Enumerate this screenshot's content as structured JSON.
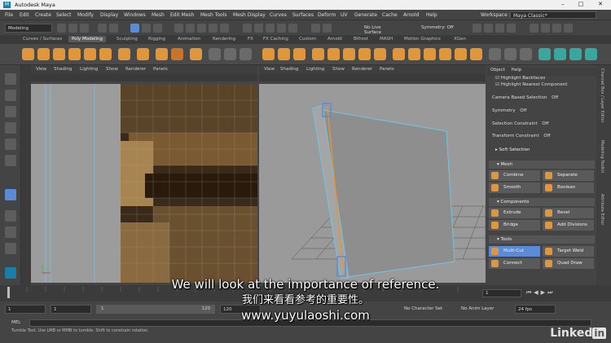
{
  "window": {
    "title": "Autodesk Maya",
    "logo": "M"
  },
  "menus": [
    "File",
    "Edit",
    "Create",
    "Select",
    "Modify",
    "Display",
    "Windows",
    "Mesh",
    "Edit Mesh",
    "Mesh Tools",
    "Mesh Display",
    "Curves",
    "Surfaces",
    "Deform",
    "UV",
    "Generate",
    "Cache",
    "Arnold",
    "Help"
  ],
  "workspace": {
    "label": "Workspace :",
    "value": "Maya Classic*"
  },
  "statusline": {
    "mode": "Modeling",
    "live_surface": "No Live Surface",
    "symmetry": "Symmetry: Off"
  },
  "shelf_tabs": [
    "Curves / Surfaces",
    "Poly Modeling",
    "Sculpting",
    "Rigging",
    "Animation",
    "Rendering",
    "FX",
    "FX Caching",
    "Custom",
    "Arnold",
    "Bifrost",
    "MASH",
    "Motion Graphics",
    "XGen"
  ],
  "shelf_active": "Poly Modeling",
  "panel_menus": [
    "View",
    "Shading",
    "Lighting",
    "Show",
    "Renderer",
    "Panels"
  ],
  "attr_menus": [
    "Object",
    "Help"
  ],
  "attr": {
    "highlight_backfaces": "Highlight Backfaces",
    "highlight_nearest": "Highlight Nearest Component",
    "camera_selection": {
      "label": "Camera Based Selection",
      "value": "Off"
    },
    "symmetry": {
      "label": "Symmetry",
      "value": "Off"
    },
    "selection_constraint": {
      "label": "Selection Constraint",
      "value": "Off"
    },
    "transform_constraint": {
      "label": "Transform Constraint",
      "value": "Off"
    },
    "soft_selection": "Soft Selection",
    "sections": {
      "mesh": {
        "title": "Mesh",
        "buttons": [
          "Combine",
          "Separate",
          "Smooth",
          "Boolean"
        ]
      },
      "components": {
        "title": "Components",
        "buttons": [
          "Extrude",
          "Bevel",
          "Bridge",
          "Add Divisions"
        ]
      },
      "tools": {
        "title": "Tools",
        "buttons": [
          "Multi-Cut",
          "Target Weld",
          "Connect",
          "Quad Draw"
        ]
      }
    }
  },
  "side_tabs": [
    "Channel Box / Layer Editor",
    "Modeling Toolkit",
    "Attribute Editor"
  ],
  "range": {
    "start": "1",
    "current": "1",
    "slider_start": "1",
    "slider_end": "120",
    "end": "120",
    "no_char_set": "No Character Set",
    "no_anim_layer": "No Anim Layer",
    "fps": "24 fps"
  },
  "timeline_frame": "1",
  "mel": {
    "label": "MEL",
    "help": "Tumble Tool: Use LMB or MMB to tumble. Shift to constrain rotation."
  },
  "subtitles": {
    "en": "We will look at the importance of reference.",
    "zh": "我们来看看参考的重要性。",
    "url": "www.yuyulaoshi.com"
  },
  "watermark": {
    "text": "Linked",
    "box": "in"
  },
  "colors": {
    "accent": "#e1963a",
    "selection": "#5a8bd6",
    "wire": "#6ec6e6",
    "bg": "#444444"
  }
}
